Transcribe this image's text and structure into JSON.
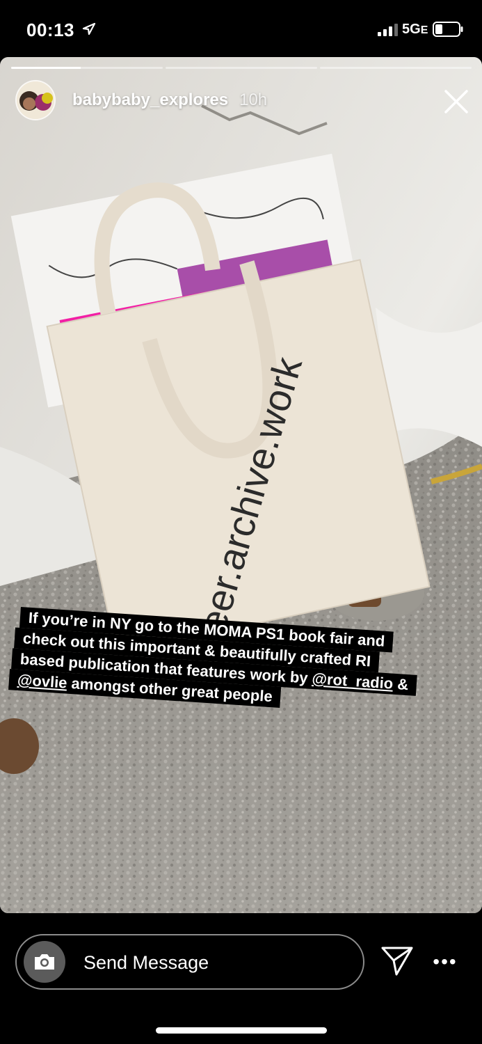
{
  "status_bar": {
    "time": "00:13",
    "network": "5G",
    "network_suffix": "E",
    "icons": [
      "location-arrow-icon",
      "signal-bars-icon",
      "battery-icon"
    ]
  },
  "story": {
    "username": "babybaby_explores",
    "age": "10h",
    "progress_segments": [
      1,
      0,
      0
    ],
    "photo_text": "queer.archive.work",
    "caption_lines": [
      {
        "text": "If you’re in NY go to the MOMA PS1 book fair and",
        "mention": ""
      },
      {
        "text": "check out this important & beautifully crafted RI",
        "mention": ""
      },
      {
        "text": "based publication that features work by ",
        "mention": "@rot_radio",
        "after": " &"
      },
      {
        "text": "",
        "mention": "@ovlie",
        "after": " amongst other great people"
      }
    ]
  },
  "bottom_bar": {
    "message_placeholder": "Send Message",
    "more_label": "•••",
    "icons": [
      "camera-icon",
      "send-icon",
      "more-icon"
    ]
  }
}
